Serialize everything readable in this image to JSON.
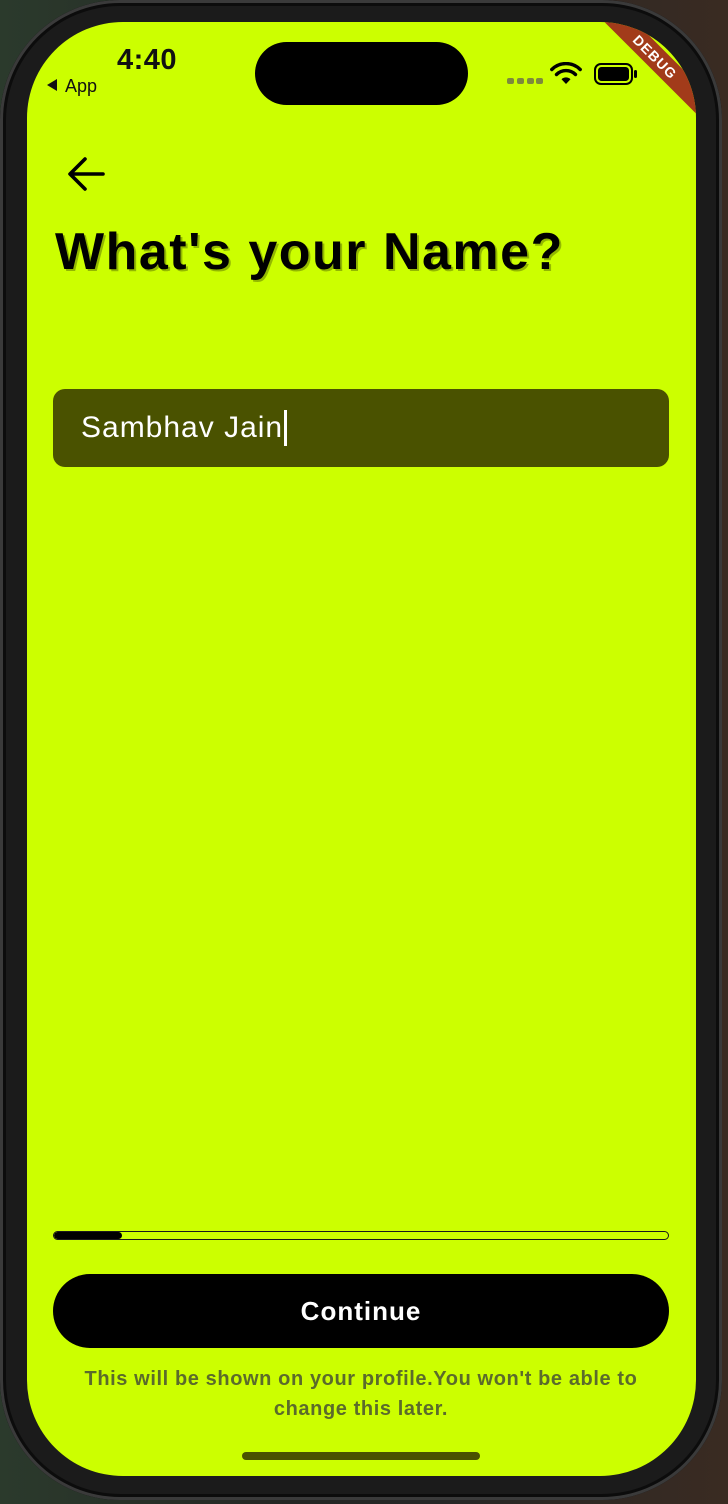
{
  "status_bar": {
    "time": "4:40",
    "back_app_label": "App",
    "debug_banner": "DEBUG"
  },
  "header": {
    "back_icon": "arrow-left-icon",
    "title": "What's your Name?"
  },
  "name_input": {
    "value": "Sambhav Jain",
    "focused": true
  },
  "progress": {
    "fraction": 0.11
  },
  "actions": {
    "continue_label": "Continue"
  },
  "footer": {
    "note": "This will be shown on your profile.You won't be able to change this later."
  },
  "colors": {
    "background": "#ccff00",
    "field_background": "#4a5200",
    "button_background": "#000000",
    "debug_banner": "#a23b1a"
  }
}
